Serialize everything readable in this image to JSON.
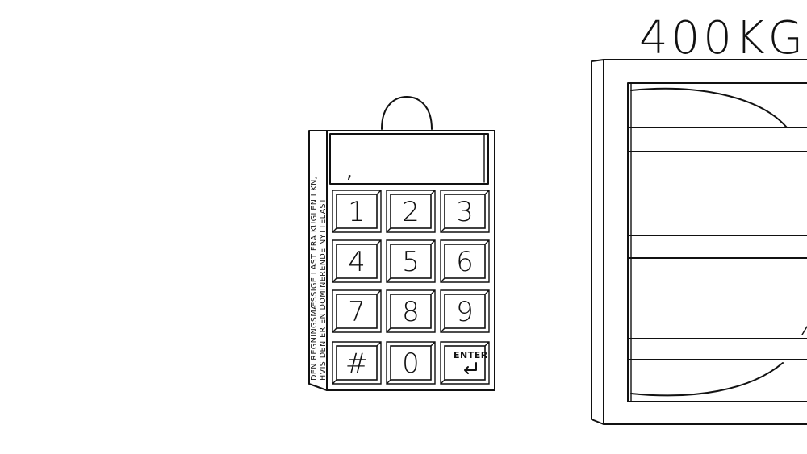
{
  "keypad": {
    "display": "_, _ _ _ _ _",
    "side_text_line1": "DEN REGNINGSMÆSSIGE LAST FRA KUGLEN I KN,",
    "side_text_line2": "HVIS DEN ER EN DOMINERENDE NYTTELAST",
    "keys": [
      {
        "label": "1"
      },
      {
        "label": "2"
      },
      {
        "label": "3"
      },
      {
        "label": "4"
      },
      {
        "label": "5"
      },
      {
        "label": "6"
      },
      {
        "label": "7"
      },
      {
        "label": "8"
      },
      {
        "label": "9"
      },
      {
        "label": "#"
      },
      {
        "label": "0"
      },
      {
        "label": "ENTER",
        "icon": "enter-arrow-icon"
      }
    ]
  },
  "weight": {
    "label": "400KG"
  },
  "colors": {
    "ink": "#111111",
    "background": "#ffffff"
  }
}
